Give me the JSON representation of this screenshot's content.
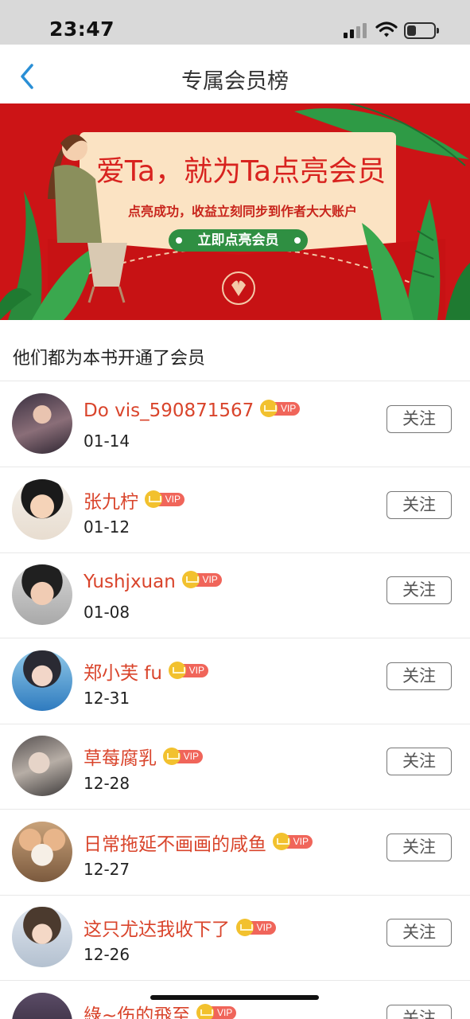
{
  "status_bar": {
    "time": "23:47",
    "battery_level": 0.35
  },
  "nav": {
    "title": "专属会员榜",
    "back_icon": "chevron-left-icon"
  },
  "banner": {
    "headline": "爱Ta，就为Ta点亮会员",
    "subline": "点亮成功，收益立刻同步到作者大大账户",
    "cta_label": "立即点亮会员",
    "colors": {
      "background": "#cc1416",
      "card": "#fbe3c3",
      "cta": "#2f8f42"
    }
  },
  "section": {
    "title": "他们都为本书开通了会员"
  },
  "members": [
    {
      "name": "Do vis_590871567",
      "date": "01-14",
      "badge": "VIP",
      "follow_label": "关注"
    },
    {
      "name": "张九柠",
      "date": "01-12",
      "badge": "VIP",
      "follow_label": "关注"
    },
    {
      "name": "Yushjxuan",
      "date": "01-08",
      "badge": "VIP",
      "follow_label": "关注"
    },
    {
      "name": "郑小芙 fu",
      "date": "12-31",
      "badge": "VIP",
      "follow_label": "关注"
    },
    {
      "name": "草莓腐乳",
      "date": "12-28",
      "badge": "VIP",
      "follow_label": "关注"
    },
    {
      "name": "日常拖延不画画的咸鱼",
      "date": "12-27",
      "badge": "VIP",
      "follow_label": "关注"
    },
    {
      "name": "这只尤达我收下了",
      "date": "12-26",
      "badge": "VIP",
      "follow_label": "关注"
    },
    {
      "name": "綠~伤的飛至",
      "date": "",
      "badge": "VIP",
      "follow_label": "关注"
    }
  ]
}
